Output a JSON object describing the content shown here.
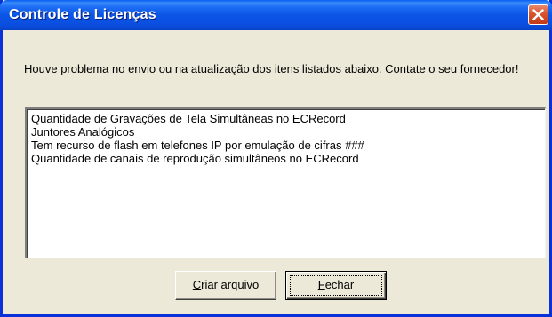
{
  "window": {
    "title": "Controle de Licenças"
  },
  "message": "Houve problema no envio ou na atualização dos itens listados abaixo. Contate o seu fornecedor!",
  "items": [
    "Quantidade de Gravações de Tela Simultâneas no ECRecord",
    "Juntores Analógicos",
    "Tem recurso de flash em telefones IP por emulação de cifras ###",
    "Quantidade de canais de reprodução simultâneos no ECRecord"
  ],
  "buttons": {
    "criar_mnemonic": "C",
    "criar_rest": "riar arquivo",
    "fechar_mnemonic": "F",
    "fechar_rest": "echar"
  },
  "icons": {
    "close": "close-icon"
  }
}
